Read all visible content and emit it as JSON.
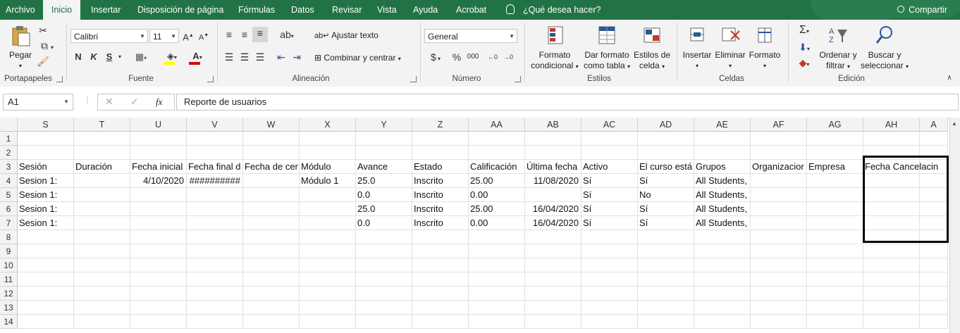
{
  "tabs": [
    "Archivo",
    "Inicio",
    "Insertar",
    "Disposición de página",
    "Fórmulas",
    "Datos",
    "Revisar",
    "Vista",
    "Ayuda",
    "Acrobat"
  ],
  "active_tab": "Inicio",
  "tell_me": "¿Qué desea hacer?",
  "share": "Compartir",
  "ribbon": {
    "clipboard": {
      "paste": "Pegar",
      "label": "Portapapeles"
    },
    "font": {
      "name": "Calibri",
      "size": "11",
      "bold": "N",
      "italic": "K",
      "underline": "S",
      "label": "Fuente"
    },
    "alignment": {
      "wrap": "Ajustar texto",
      "merge": "Combinar y centrar",
      "label": "Alineación"
    },
    "number": {
      "format": "General",
      "currency": "$",
      "percent": "%",
      "thousands": "000",
      "label": "Número"
    },
    "styles": {
      "conditional_1": "Formato",
      "conditional_2": "condicional",
      "table_1": "Dar formato",
      "table_2": "como tabla",
      "cell_1": "Estilos de",
      "cell_2": "celda",
      "label": "Estilos"
    },
    "cells": {
      "insert": "Insertar",
      "delete": "Eliminar",
      "format": "Formato",
      "label": "Celdas"
    },
    "editing": {
      "sort_1": "Ordenar y",
      "sort_2": "filtrar",
      "find_1": "Buscar y",
      "find_2": "seleccionar",
      "label": "Edición"
    }
  },
  "formula_bar": {
    "name_box": "A1",
    "fx": "fx",
    "content": "Reporte de usuarios"
  },
  "columns": [
    "S",
    "T",
    "U",
    "V",
    "W",
    "X",
    "Y",
    "Z",
    "AA",
    "AB",
    "AC",
    "AD",
    "AE",
    "AF",
    "AG",
    "AH",
    "A"
  ],
  "rows": [
    "1",
    "2",
    "3",
    "4",
    "5",
    "6",
    "7",
    "8",
    "9",
    "10",
    "11",
    "12",
    "13",
    "14"
  ],
  "cells": {
    "r3": [
      "Sesión",
      "Duración",
      "Fecha inicial",
      "Fecha final d",
      "Fecha de cer",
      "Módulo",
      "Avance",
      "Estado",
      "Calificación",
      "Última fecha",
      "Activo",
      "El curso está",
      "Grupos",
      "Organizacior",
      "Empresa",
      "Fecha Cancelacin"
    ],
    "r4": [
      "Sesion 1:",
      "",
      "4/10/2020",
      "##########",
      "",
      "Módulo 1",
      "25.0",
      "Inscrito",
      "25.00",
      "11/08/2020",
      "Sí",
      "Sí",
      "All Students,",
      "",
      "",
      ""
    ],
    "r5": [
      "Sesion 1:",
      "",
      "",
      "",
      "",
      "",
      "0.0",
      "Inscrito",
      "0.00",
      "",
      "Sí",
      "No",
      "All Students,",
      "",
      "",
      ""
    ],
    "r6": [
      "Sesion 1:",
      "",
      "",
      "",
      "",
      "",
      "25.0",
      "Inscrito",
      "25.00",
      "16/04/2020",
      "Sí",
      "Sí",
      "All Students,",
      "",
      "",
      ""
    ],
    "r7": [
      "Sesion 1:",
      "",
      "",
      "",
      "",
      "",
      "0.0",
      "Inscrito",
      "0.00",
      "16/04/2020",
      "Sí",
      "Sí",
      "All Students,",
      "",
      "",
      ""
    ]
  },
  "colors": {
    "ribbon_green": "#217346",
    "ribbon_bg": "#f3f3f3",
    "highlight": "#000000"
  }
}
